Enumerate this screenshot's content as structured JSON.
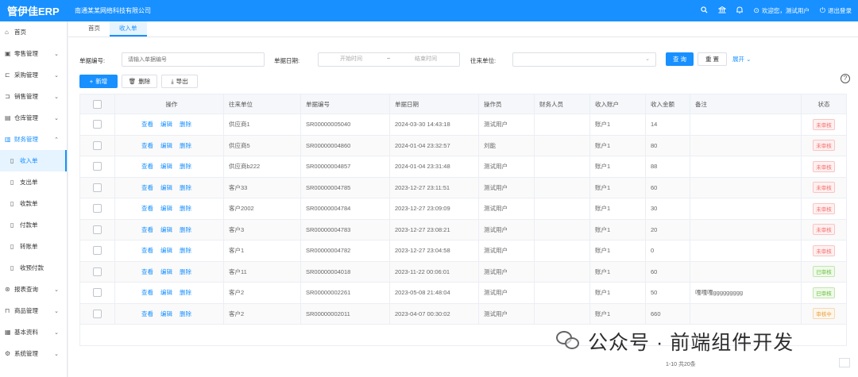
{
  "header": {
    "logo": "管伊佳ERP",
    "company": "南通某某网络科技有限公司",
    "welcome": "欢迎您，测试用户",
    "logout": "退出登录"
  },
  "sidebar": {
    "items": [
      {
        "label": "首页",
        "icon": "home-icon"
      },
      {
        "label": "零售管理",
        "icon": "shop-icon",
        "chev": "⌄"
      },
      {
        "label": "采购管理",
        "icon": "purchase-icon",
        "chev": "⌄"
      },
      {
        "label": "销售管理",
        "icon": "sales-icon",
        "chev": "⌄"
      },
      {
        "label": "仓库管理",
        "icon": "warehouse-icon",
        "chev": "⌄"
      },
      {
        "label": "财务管理",
        "icon": "finance-icon",
        "chev": "⌃"
      },
      {
        "label": "收入单",
        "icon": "doc-icon"
      },
      {
        "label": "支出单",
        "icon": "doc-icon"
      },
      {
        "label": "收款单",
        "icon": "doc-icon"
      },
      {
        "label": "付款单",
        "icon": "doc-icon"
      },
      {
        "label": "转账单",
        "icon": "doc-icon"
      },
      {
        "label": "收预付款",
        "icon": "doc-icon"
      },
      {
        "label": "报表查询",
        "icon": "report-icon",
        "chev": "⌄"
      },
      {
        "label": "商品管理",
        "icon": "goods-icon",
        "chev": "⌄"
      },
      {
        "label": "基本资料",
        "icon": "basic-icon",
        "chev": "⌄"
      },
      {
        "label": "系统管理",
        "icon": "settings-icon",
        "chev": "⌄"
      }
    ]
  },
  "tabs": [
    {
      "label": "首页"
    },
    {
      "label": "收入单"
    }
  ],
  "filters": {
    "billno_label": "单据编号:",
    "billno_placeholder": "请输入单据编号",
    "date_label": "单据日期:",
    "date_start": "开始时间",
    "date_sep": "~",
    "date_end": "结束时间",
    "org_label": "往来单位:",
    "query": "查 询",
    "reset": "重 置",
    "expand": "展开"
  },
  "toolbar": {
    "add": "新增",
    "delete": "删除",
    "export": "导出"
  },
  "table": {
    "headers": [
      "操作",
      "往来单位",
      "单据编号",
      "单据日期",
      "操作员",
      "财务人员",
      "收入账户",
      "收入金额",
      "备注",
      "状态"
    ],
    "ops": [
      "查看",
      "编辑",
      "删除"
    ],
    "rows": [
      {
        "org": "供应商1",
        "no": "SR00000005040",
        "date": "2024-03-30 14:43:18",
        "op": "测试用户",
        "fin": "",
        "acct": "账户1",
        "amt": "14",
        "remark": "",
        "status": "未审核",
        "tone": "red"
      },
      {
        "org": "供应商5",
        "no": "SR00000004860",
        "date": "2024-01-04 23:32:57",
        "op": "刘能",
        "fin": "",
        "acct": "账户1",
        "amt": "80",
        "remark": "",
        "status": "未审核",
        "tone": "red"
      },
      {
        "org": "供应商b222",
        "no": "SR00000004857",
        "date": "2024-01-04 23:31:48",
        "op": "测试用户",
        "fin": "",
        "acct": "账户1",
        "amt": "88",
        "remark": "",
        "status": "未审核",
        "tone": "red"
      },
      {
        "org": "客户33",
        "no": "SR00000004785",
        "date": "2023-12-27 23:11:51",
        "op": "测试用户",
        "fin": "",
        "acct": "账户1",
        "amt": "60",
        "remark": "",
        "status": "未审核",
        "tone": "red"
      },
      {
        "org": "客户2002",
        "no": "SR00000004784",
        "date": "2023-12-27 23:09:09",
        "op": "测试用户",
        "fin": "",
        "acct": "账户1",
        "amt": "30",
        "remark": "",
        "status": "未审核",
        "tone": "red"
      },
      {
        "org": "客户3",
        "no": "SR00000004783",
        "date": "2023-12-27 23:08:21",
        "op": "测试用户",
        "fin": "",
        "acct": "账户1",
        "amt": "20",
        "remark": "",
        "status": "未审核",
        "tone": "red"
      },
      {
        "org": "客户1",
        "no": "SR00000004782",
        "date": "2023-12-27 23:04:58",
        "op": "测试用户",
        "fin": "",
        "acct": "账户1",
        "amt": "0",
        "remark": "",
        "status": "未审核",
        "tone": "red"
      },
      {
        "org": "客户11",
        "no": "SR00000004018",
        "date": "2023-11-22 00:06:01",
        "op": "测试用户",
        "fin": "",
        "acct": "账户1",
        "amt": "60",
        "remark": "",
        "status": "已审核",
        "tone": "green"
      },
      {
        "org": "客户2",
        "no": "SR00000002261",
        "date": "2023-05-08 21:48:04",
        "op": "测试用户",
        "fin": "",
        "acct": "账户1",
        "amt": "50",
        "remark": "嘎嘎嘎ggggggggg",
        "status": "已审核",
        "tone": "green"
      },
      {
        "org": "客户2",
        "no": "SR00000002011",
        "date": "2023-04-07 00:30:02",
        "op": "测试用户",
        "fin": "",
        "acct": "账户1",
        "amt": "660",
        "remark": "",
        "status": "审核中",
        "tone": "orange"
      }
    ]
  },
  "pagination": {
    "summary": "1-10 共20条"
  },
  "watermark": "公众号 · 前端组件开发",
  "colors": {
    "primary": "#1890ff",
    "danger": "#f56c6c",
    "success": "#67c23a",
    "warning": "#e6a23c"
  }
}
